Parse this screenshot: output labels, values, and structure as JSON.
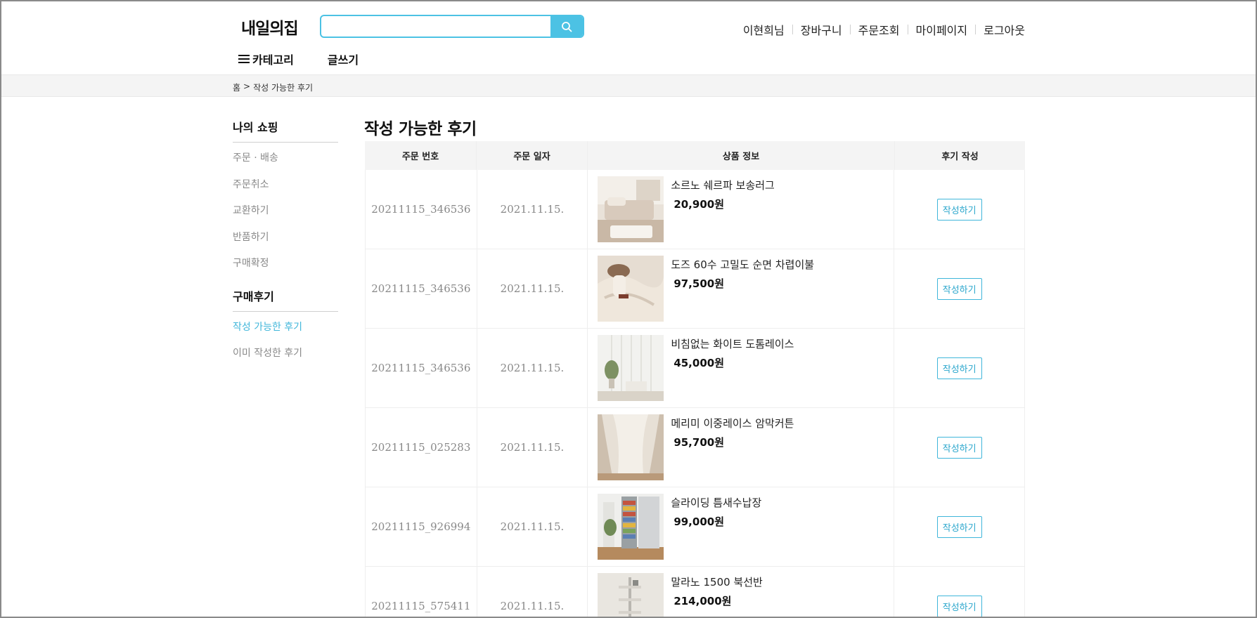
{
  "header": {
    "logo": "내일의집",
    "search": {
      "value": "",
      "placeholder": ""
    },
    "links": [
      "이현희님",
      "장바구니",
      "주문조회",
      "마이페이지",
      "로그아웃"
    ],
    "nav": {
      "category": "카테고리",
      "write": "글쓰기"
    }
  },
  "breadcrumb": {
    "home": "홈",
    "separator": ">",
    "current": "작성 가능한 후기"
  },
  "sidebar": {
    "group1": {
      "title": "나의 쇼핑",
      "items": [
        "주문 · 배송",
        "주문취소",
        "교환하기",
        "반품하기",
        "구매확정"
      ]
    },
    "group2": {
      "title": "구매후기",
      "items": [
        "작성 가능한 후기",
        "이미 작성한 후기"
      ],
      "active_index": 0
    }
  },
  "main": {
    "title": "작성 가능한 후기",
    "columns": [
      "주문 번호",
      "주문 일자",
      "상품 정보",
      "후기 작성"
    ],
    "rows": [
      {
        "order_no": "20211115_346536",
        "date": "2021.11.15.",
        "name": "소르노 쉐르파 보송러그",
        "price": "20,900원",
        "action": "작성하기",
        "thumb": "rug-bedroom"
      },
      {
        "order_no": "20211115_346536",
        "date": "2021.11.15.",
        "name": "도즈 60수 고밀도 순면 차렵이불",
        "price": "97,500원",
        "action": "작성하기",
        "thumb": "duvet"
      },
      {
        "order_no": "20211115_346536",
        "date": "2021.11.15.",
        "name": "비침없는 화이트 도톰레이스",
        "price": "45,000원",
        "action": "작성하기",
        "thumb": "lace-curtain"
      },
      {
        "order_no": "20211115_025283",
        "date": "2021.11.15.",
        "name": "메리미 이중레이스 암막커튼",
        "price": "95,700원",
        "action": "작성하기",
        "thumb": "blackout-curtain"
      },
      {
        "order_no": "20211115_926994",
        "date": "2021.11.15.",
        "name": "슬라이딩 틈새수납장",
        "price": "99,000원",
        "action": "작성하기",
        "thumb": "slim-storage"
      },
      {
        "order_no": "20211115_575411",
        "date": "2021.11.15.",
        "name": "말라노 1500 북선반",
        "price": "214,000원",
        "action": "작성하기",
        "thumb": "bookshelf"
      }
    ]
  },
  "colors": {
    "accent": "#4cc2e4",
    "active_text": "#3fb6da"
  }
}
